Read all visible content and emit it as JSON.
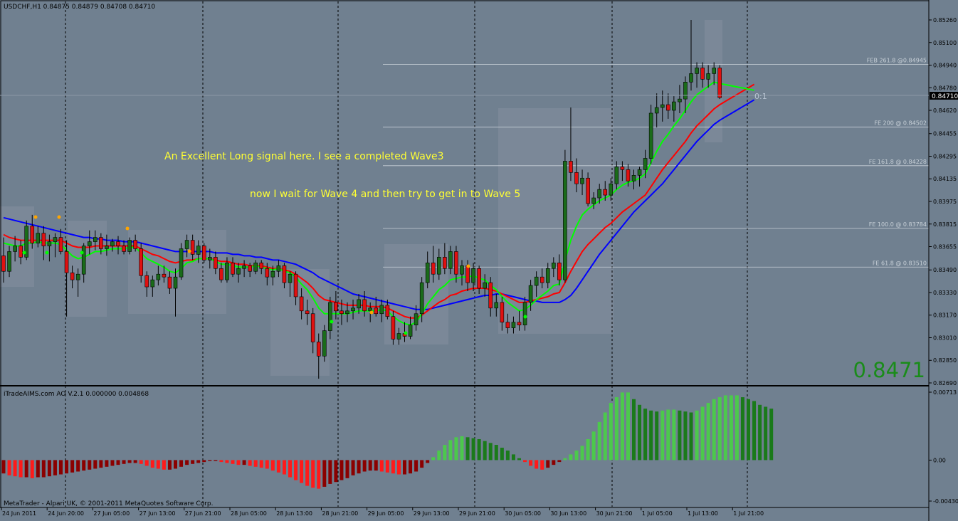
{
  "header": {
    "symbol_info": "USDCHF,H1  0.84875 0.84879 0.84708 0.84710"
  },
  "indicator": {
    "title": "iTradeAIMS.com AO V.2.1 0.000000 0.004868",
    "scale_labels": [
      "0.00713",
      "0.00",
      "-0.00430"
    ],
    "positive_color": "#1a7a1a",
    "positive_light_color": "#4cc94c",
    "negative_color": "#ff1a1a",
    "negative_dark_color": "#8b0000"
  },
  "footer": {
    "copyright": "MetaTrader - Alpari UK, © 2001-2011 MetaQuotes Software Corp."
  },
  "current_price": {
    "big_label": "0.8471",
    "axis_label": "0.84710",
    "color": "#1a8c1a"
  },
  "annotations": {
    "line1": "An Excellent  Long signal here. I see a completed Wave3",
    "line2": "now I wait for Wave 4 and then try to get in to Wave 5",
    "color": "#ffff33"
  },
  "fib_levels": [
    {
      "label": "FEB 261.8 @0.84945",
      "price": 0.84945
    },
    {
      "label": "FE 200  @ 0.84502",
      "price": 0.84502
    },
    {
      "label": "FE 161.8  @ 0.84228",
      "price": 0.84228
    },
    {
      "label": "FE 100.0  @ 0.83784",
      "price": 0.83784
    },
    {
      "label": "FE 61.8  @ 0.83510",
      "price": 0.8351
    }
  ],
  "fib_marker": "0:1",
  "price_axis": [
    "0.85260",
    "0.85100",
    "0.84940",
    "0.84780",
    "0.84620",
    "0.84455",
    "0.84295",
    "0.84135",
    "0.83975",
    "0.83815",
    "0.83655",
    "0.83490",
    "0.83330",
    "0.83170",
    "0.83010",
    "0.82850",
    "0.82690"
  ],
  "time_axis": [
    "24 Jun 2011",
    "24 Jun 20:00",
    "27 Jun 05:00",
    "27 Jun 13:00",
    "27 Jun 21:00",
    "28 Jun 05:00",
    "28 Jun 13:00",
    "28 Jun 21:00",
    "29 Jun 05:00",
    "29 Jun 13:00",
    "29 Jun 21:00",
    "30 Jun 05:00",
    "30 Jun 13:00",
    "30 Jun 21:00",
    "1 Jul 05:00",
    "1 Jul 13:00",
    "1 Jul 21:00"
  ],
  "colors": {
    "background": "#708090",
    "bull_candle": "#1a6b1a",
    "bear_candle": "#e01010",
    "ma_fast": "#00ff00",
    "ma_mid": "#ff0000",
    "ma_slow": "#0000ff",
    "grid_separator": "#000000",
    "fractal_up": "#ffa500",
    "fractal_down": "#00ff00"
  },
  "chart_data": {
    "type": "candlestick",
    "ohlc": [
      [
        0.8359,
        0.8372,
        0.834,
        0.8348
      ],
      [
        0.8348,
        0.8366,
        0.8344,
        0.8362
      ],
      [
        0.8362,
        0.8373,
        0.8355,
        0.8366
      ],
      [
        0.8366,
        0.837,
        0.8353,
        0.8358
      ],
      [
        0.8358,
        0.8384,
        0.8356,
        0.838
      ],
      [
        0.838,
        0.8388,
        0.8364,
        0.8368
      ],
      [
        0.8368,
        0.838,
        0.8365,
        0.8375
      ],
      [
        0.8375,
        0.838,
        0.8356,
        0.8366
      ],
      [
        0.8366,
        0.8374,
        0.8355,
        0.8369
      ],
      [
        0.8369,
        0.8375,
        0.8358,
        0.8372
      ],
      [
        0.8372,
        0.8378,
        0.836,
        0.8362
      ],
      [
        0.8362,
        0.837,
        0.8316,
        0.8347
      ],
      [
        0.8347,
        0.8352,
        0.8336,
        0.8342
      ],
      [
        0.8342,
        0.835,
        0.833,
        0.8346
      ],
      [
        0.8346,
        0.8368,
        0.834,
        0.8366
      ],
      [
        0.8366,
        0.8377,
        0.836,
        0.8369
      ],
      [
        0.8369,
        0.8377,
        0.8363,
        0.8372
      ],
      [
        0.8372,
        0.8375,
        0.836,
        0.8364
      ],
      [
        0.8364,
        0.8374,
        0.8359,
        0.8366
      ],
      [
        0.8366,
        0.8371,
        0.8362,
        0.8369
      ],
      [
        0.8369,
        0.8373,
        0.836,
        0.8366
      ],
      [
        0.8366,
        0.837,
        0.836,
        0.8362
      ],
      [
        0.8362,
        0.8372,
        0.836,
        0.837
      ],
      [
        0.837,
        0.8374,
        0.8362,
        0.8364
      ],
      [
        0.8364,
        0.8368,
        0.834,
        0.8345
      ],
      [
        0.8345,
        0.8348,
        0.833,
        0.8337
      ],
      [
        0.8337,
        0.8345,
        0.833,
        0.8342
      ],
      [
        0.8342,
        0.8352,
        0.8338,
        0.8346
      ],
      [
        0.8346,
        0.8352,
        0.834,
        0.8344
      ],
      [
        0.8344,
        0.8348,
        0.8332,
        0.8336
      ],
      [
        0.8336,
        0.835,
        0.8316,
        0.8344
      ],
      [
        0.8344,
        0.8368,
        0.8342,
        0.8364
      ],
      [
        0.8364,
        0.8374,
        0.8358,
        0.837
      ],
      [
        0.837,
        0.8374,
        0.8356,
        0.836
      ],
      [
        0.836,
        0.837,
        0.8354,
        0.8366
      ],
      [
        0.8366,
        0.8368,
        0.8354,
        0.8356
      ],
      [
        0.8356,
        0.8364,
        0.835,
        0.8358
      ],
      [
        0.8358,
        0.8362,
        0.8346,
        0.835
      ],
      [
        0.835,
        0.8354,
        0.834,
        0.8342
      ],
      [
        0.8342,
        0.8358,
        0.834,
        0.8354
      ],
      [
        0.8354,
        0.8358,
        0.8344,
        0.8346
      ],
      [
        0.8346,
        0.8354,
        0.834,
        0.835
      ],
      [
        0.835,
        0.8356,
        0.8344,
        0.8352
      ],
      [
        0.8352,
        0.8354,
        0.8344,
        0.8348
      ],
      [
        0.8348,
        0.8356,
        0.8346,
        0.8354
      ],
      [
        0.8354,
        0.8356,
        0.8346,
        0.835
      ],
      [
        0.835,
        0.8354,
        0.8338,
        0.8344
      ],
      [
        0.8344,
        0.8352,
        0.8338,
        0.8348
      ],
      [
        0.8348,
        0.8356,
        0.8344,
        0.8352
      ],
      [
        0.8352,
        0.8354,
        0.8336,
        0.834
      ],
      [
        0.834,
        0.8348,
        0.833,
        0.8346
      ],
      [
        0.8346,
        0.8348,
        0.8324,
        0.833
      ],
      [
        0.833,
        0.8336,
        0.8314,
        0.832
      ],
      [
        0.832,
        0.8328,
        0.831,
        0.8318
      ],
      [
        0.8318,
        0.8322,
        0.829,
        0.8298
      ],
      [
        0.8298,
        0.8304,
        0.8272,
        0.8288
      ],
      [
        0.8288,
        0.831,
        0.8284,
        0.8306
      ],
      [
        0.8306,
        0.833,
        0.83,
        0.8326
      ],
      [
        0.8326,
        0.8334,
        0.8314,
        0.832
      ],
      [
        0.832,
        0.8328,
        0.831,
        0.8318
      ],
      [
        0.8318,
        0.8326,
        0.8312,
        0.832
      ],
      [
        0.832,
        0.8328,
        0.8314,
        0.8322
      ],
      [
        0.8322,
        0.8332,
        0.8318,
        0.8328
      ],
      [
        0.8328,
        0.8334,
        0.8316,
        0.832
      ],
      [
        0.832,
        0.8326,
        0.8312,
        0.8322
      ],
      [
        0.8322,
        0.833,
        0.8316,
        0.8318
      ],
      [
        0.8318,
        0.8328,
        0.8312,
        0.8324
      ],
      [
        0.8324,
        0.8328,
        0.8314,
        0.8316
      ],
      [
        0.8316,
        0.832,
        0.8296,
        0.83
      ],
      [
        0.83,
        0.8308,
        0.8296,
        0.8304
      ],
      [
        0.8304,
        0.8312,
        0.8298,
        0.8302
      ],
      [
        0.8302,
        0.8316,
        0.83,
        0.831
      ],
      [
        0.831,
        0.8324,
        0.8306,
        0.8318
      ],
      [
        0.8318,
        0.8344,
        0.8312,
        0.834
      ],
      [
        0.834,
        0.8362,
        0.8336,
        0.8354
      ],
      [
        0.8354,
        0.8366,
        0.834,
        0.8346
      ],
      [
        0.8346,
        0.8364,
        0.8342,
        0.8358
      ],
      [
        0.8358,
        0.8368,
        0.8346,
        0.835
      ],
      [
        0.835,
        0.8366,
        0.8346,
        0.8362
      ],
      [
        0.8362,
        0.8366,
        0.834,
        0.8346
      ],
      [
        0.8346,
        0.8356,
        0.8338,
        0.8352
      ],
      [
        0.8352,
        0.8356,
        0.8334,
        0.834
      ],
      [
        0.834,
        0.8354,
        0.8334,
        0.835
      ],
      [
        0.835,
        0.8352,
        0.8332,
        0.8336
      ],
      [
        0.8336,
        0.8346,
        0.833,
        0.834
      ],
      [
        0.834,
        0.8344,
        0.8316,
        0.8322
      ],
      [
        0.8322,
        0.8332,
        0.8316,
        0.8326
      ],
      [
        0.8326,
        0.833,
        0.8306,
        0.8312
      ],
      [
        0.8312,
        0.8318,
        0.8304,
        0.8308
      ],
      [
        0.8308,
        0.8316,
        0.8304,
        0.8312
      ],
      [
        0.8312,
        0.832,
        0.8306,
        0.831
      ],
      [
        0.831,
        0.833,
        0.8306,
        0.8326
      ],
      [
        0.8326,
        0.8342,
        0.832,
        0.8338
      ],
      [
        0.8338,
        0.8348,
        0.833,
        0.8344
      ],
      [
        0.8344,
        0.835,
        0.8336,
        0.834
      ],
      [
        0.834,
        0.8354,
        0.8336,
        0.835
      ],
      [
        0.835,
        0.8358,
        0.8344,
        0.8354
      ],
      [
        0.8354,
        0.836,
        0.8338,
        0.8342
      ],
      [
        0.8342,
        0.8434,
        0.834,
        0.8426
      ],
      [
        0.8426,
        0.8464,
        0.8412,
        0.8418
      ],
      [
        0.8418,
        0.8428,
        0.8404,
        0.841
      ],
      [
        0.841,
        0.842,
        0.8402,
        0.8414
      ],
      [
        0.8414,
        0.8418,
        0.8394,
        0.8396
      ],
      [
        0.8396,
        0.8404,
        0.8392,
        0.84
      ],
      [
        0.84,
        0.841,
        0.8396,
        0.8406
      ],
      [
        0.8406,
        0.8412,
        0.8398,
        0.8402
      ],
      [
        0.8402,
        0.8414,
        0.8398,
        0.841
      ],
      [
        0.841,
        0.8426,
        0.8406,
        0.8422
      ],
      [
        0.8422,
        0.8426,
        0.8412,
        0.842
      ],
      [
        0.842,
        0.8424,
        0.8408,
        0.8412
      ],
      [
        0.8412,
        0.842,
        0.8406,
        0.8416
      ],
      [
        0.8416,
        0.8422,
        0.8408,
        0.842
      ],
      [
        0.842,
        0.8434,
        0.8414,
        0.8428
      ],
      [
        0.8428,
        0.8466,
        0.8424,
        0.846
      ],
      [
        0.846,
        0.8474,
        0.845,
        0.8464
      ],
      [
        0.8464,
        0.8476,
        0.8454,
        0.8466
      ],
      [
        0.8466,
        0.8474,
        0.8456,
        0.8462
      ],
      [
        0.8462,
        0.8472,
        0.8454,
        0.8468
      ],
      [
        0.8468,
        0.848,
        0.846,
        0.847
      ],
      [
        0.847,
        0.8486,
        0.846,
        0.8482
      ],
      [
        0.8482,
        0.8526,
        0.8476,
        0.8488
      ],
      [
        0.8488,
        0.8496,
        0.8478,
        0.8492
      ],
      [
        0.8492,
        0.8496,
        0.8478,
        0.8484
      ],
      [
        0.8484,
        0.8494,
        0.8478,
        0.8488
      ],
      [
        0.8488,
        0.8496,
        0.848,
        0.8492
      ],
      [
        0.8492,
        0.8494,
        0.847,
        0.8471
      ]
    ],
    "ma_fast": [
      0.8368,
      0.8367,
      0.8366,
      0.8366,
      0.8368,
      0.8368,
      0.8369,
      0.8368,
      0.8368,
      0.8368,
      0.8367,
      0.8363,
      0.8359,
      0.8357,
      0.8358,
      0.836,
      0.8362,
      0.8362,
      0.8363,
      0.8364,
      0.8364,
      0.8364,
      0.8365,
      0.8365,
      0.8361,
      0.8357,
      0.8355,
      0.8353,
      0.8351,
      0.8348,
      0.8347,
      0.835,
      0.8354,
      0.8355,
      0.8357,
      0.8357,
      0.8357,
      0.8355,
      0.8353,
      0.8353,
      0.8352,
      0.8351,
      0.8351,
      0.8351,
      0.8352,
      0.8351,
      0.835,
      0.8349,
      0.835,
      0.8348,
      0.8347,
      0.8344,
      0.8339,
      0.8335,
      0.8329,
      0.8322,
      0.8318,
      0.8318,
      0.8318,
      0.8318,
      0.8318,
      0.8319,
      0.832,
      0.832,
      0.832,
      0.832,
      0.8321,
      0.832,
      0.8316,
      0.8313,
      0.8311,
      0.831,
      0.8312,
      0.8318,
      0.8325,
      0.833,
      0.8335,
      0.8338,
      0.8342,
      0.8343,
      0.8344,
      0.8344,
      0.8345,
      0.8343,
      0.8342,
      0.8338,
      0.8335,
      0.833,
      0.8326,
      0.8323,
      0.832,
      0.8321,
      0.8324,
      0.8328,
      0.8331,
      0.8334,
      0.8338,
      0.8339,
      0.8356,
      0.837,
      0.838,
      0.8388,
      0.8392,
      0.8395,
      0.8398,
      0.84,
      0.8402,
      0.8406,
      0.8409,
      0.8411,
      0.8412,
      0.8414,
      0.8417,
      0.8425,
      0.8433,
      0.844,
      0.8445,
      0.8451,
      0.8456,
      0.8462,
      0.8468,
      0.8473,
      0.8476,
      0.8479,
      0.8482,
      0.8481
    ],
    "ma_mid": [
      0.8374,
      0.8372,
      0.8371,
      0.837,
      0.837,
      0.837,
      0.837,
      0.837,
      0.837,
      0.837,
      0.837,
      0.8368,
      0.8366,
      0.8365,
      0.8365,
      0.8365,
      0.8366,
      0.8366,
      0.8366,
      0.8366,
      0.8366,
      0.8366,
      0.8366,
      0.8366,
      0.8364,
      0.8362,
      0.836,
      0.8359,
      0.8357,
      0.8355,
      0.8354,
      0.8355,
      0.8356,
      0.8356,
      0.8357,
      0.8357,
      0.8357,
      0.8356,
      0.8355,
      0.8355,
      0.8354,
      0.8353,
      0.8353,
      0.8352,
      0.8352,
      0.8352,
      0.8351,
      0.835,
      0.835,
      0.8349,
      0.8348,
      0.8346,
      0.8343,
      0.834,
      0.8336,
      0.8331,
      0.8328,
      0.8327,
      0.8326,
      0.8325,
      0.8324,
      0.8324,
      0.8324,
      0.8324,
      0.8323,
      0.8323,
      0.8323,
      0.8322,
      0.832,
      0.8318,
      0.8316,
      0.8315,
      0.8315,
      0.8317,
      0.832,
      0.8323,
      0.8326,
      0.8328,
      0.8331,
      0.8332,
      0.8334,
      0.8335,
      0.8336,
      0.8336,
      0.8336,
      0.8335,
      0.8334,
      0.8332,
      0.833,
      0.8328,
      0.8326,
      0.8326,
      0.8327,
      0.8328,
      0.8329,
      0.833,
      0.8332,
      0.8333,
      0.834,
      0.8348,
      0.8355,
      0.8362,
      0.8367,
      0.8371,
      0.8375,
      0.8379,
      0.8382,
      0.8386,
      0.839,
      0.8393,
      0.8396,
      0.8399,
      0.8402,
      0.8408,
      0.8414,
      0.842,
      0.8425,
      0.843,
      0.8435,
      0.844,
      0.8446,
      0.8451,
      0.8455,
      0.8459,
      0.8463,
      0.8466
    ],
    "ma_slow": [
      0.8386,
      0.8385,
      0.8384,
      0.8383,
      0.8382,
      0.8381,
      0.838,
      0.8379,
      0.8378,
      0.8377,
      0.8376,
      0.8375,
      0.8374,
      0.8373,
      0.8372,
      0.8372,
      0.8371,
      0.8371,
      0.837,
      0.837,
      0.837,
      0.8369,
      0.8369,
      0.8369,
      0.8368,
      0.8367,
      0.8366,
      0.8365,
      0.8364,
      0.8363,
      0.8362,
      0.8362,
      0.8362,
      0.8362,
      0.8362,
      0.8362,
      0.8362,
      0.8361,
      0.8361,
      0.8361,
      0.836,
      0.836,
      0.8359,
      0.8359,
      0.8358,
      0.8358,
      0.8357,
      0.8356,
      0.8356,
      0.8355,
      0.8354,
      0.8353,
      0.8351,
      0.8349,
      0.8347,
      0.8344,
      0.8342,
      0.834,
      0.8338,
      0.8336,
      0.8334,
      0.8332,
      0.8331,
      0.833,
      0.8329,
      0.8328,
      0.8327,
      0.8326,
      0.8325,
      0.8324,
      0.8323,
      0.8322,
      0.8321,
      0.8321,
      0.8321,
      0.8322,
      0.8323,
      0.8324,
      0.8325,
      0.8326,
      0.8327,
      0.8328,
      0.8329,
      0.833,
      0.8331,
      0.8331,
      0.8332,
      0.8332,
      0.8331,
      0.833,
      0.8329,
      0.8328,
      0.8327,
      0.8327,
      0.8326,
      0.8326,
      0.8326,
      0.8326,
      0.8328,
      0.8331,
      0.8336,
      0.8342,
      0.8348,
      0.8354,
      0.836,
      0.8365,
      0.837,
      0.8375,
      0.838,
      0.8385,
      0.839,
      0.8394,
      0.8398,
      0.8402,
      0.8406,
      0.841,
      0.8415,
      0.842,
      0.8425,
      0.843,
      0.8435,
      0.844,
      0.8444,
      0.8448,
      0.8452,
      0.8455
    ],
    "ao": [
      -0.0014,
      -0.0016,
      -0.0017,
      -0.0018,
      -0.0018,
      -0.0019,
      -0.0018,
      -0.0018,
      -0.0017,
      -0.0016,
      -0.0015,
      -0.0014,
      -0.0013,
      -0.0012,
      -0.0011,
      -0.001,
      -0.0009,
      -0.0008,
      -0.0007,
      -0.0006,
      -0.0005,
      -0.0004,
      -0.0003,
      -0.0003,
      -0.0004,
      -0.0006,
      -0.0008,
      -0.0009,
      -0.001,
      -0.001,
      -0.0009,
      -0.0007,
      -0.0005,
      -0.0004,
      -0.0003,
      -0.0002,
      -0.0001,
      -0.0001,
      -0.0002,
      -0.0003,
      -0.0004,
      -0.0005,
      -0.0005,
      -0.0006,
      -0.0007,
      -0.0008,
      -0.0009,
      -0.0011,
      -0.0013,
      -0.0015,
      -0.0018,
      -0.0021,
      -0.0024,
      -0.0027,
      -0.0029,
      -0.003,
      -0.0028,
      -0.0025,
      -0.0023,
      -0.0021,
      -0.0019,
      -0.0016,
      -0.0014,
      -0.0012,
      -0.0011,
      -0.0011,
      -0.0012,
      -0.0013,
      -0.0014,
      -0.0015,
      -0.0015,
      -0.0014,
      -0.0012,
      -0.0008,
      -0.0003,
      0.0003,
      0.001,
      0.0016,
      0.0021,
      0.0024,
      0.0025,
      0.0024,
      0.0023,
      0.0022,
      0.002,
      0.0018,
      0.0016,
      0.0013,
      0.001,
      0.0006,
      0.0002,
      -0.0002,
      -0.0006,
      -0.0009,
      -0.001,
      -0.0008,
      -0.0005,
      -0.0002,
      0.0002,
      0.0006,
      0.001,
      0.0015,
      0.0022,
      0.003,
      0.004,
      0.005,
      0.006,
      0.0066,
      0.0071,
      0.0071,
      0.0064,
      0.0058,
      0.0054,
      0.0052,
      0.0051,
      0.0052,
      0.0053,
      0.0053,
      0.0052,
      0.0051,
      0.005,
      0.0052,
      0.0056,
      0.006,
      0.0064,
      0.0066,
      0.0068,
      0.0068,
      0.0068,
      0.0066,
      0.0064,
      0.0062,
      0.0058,
      0.0056,
      0.0054
    ]
  }
}
